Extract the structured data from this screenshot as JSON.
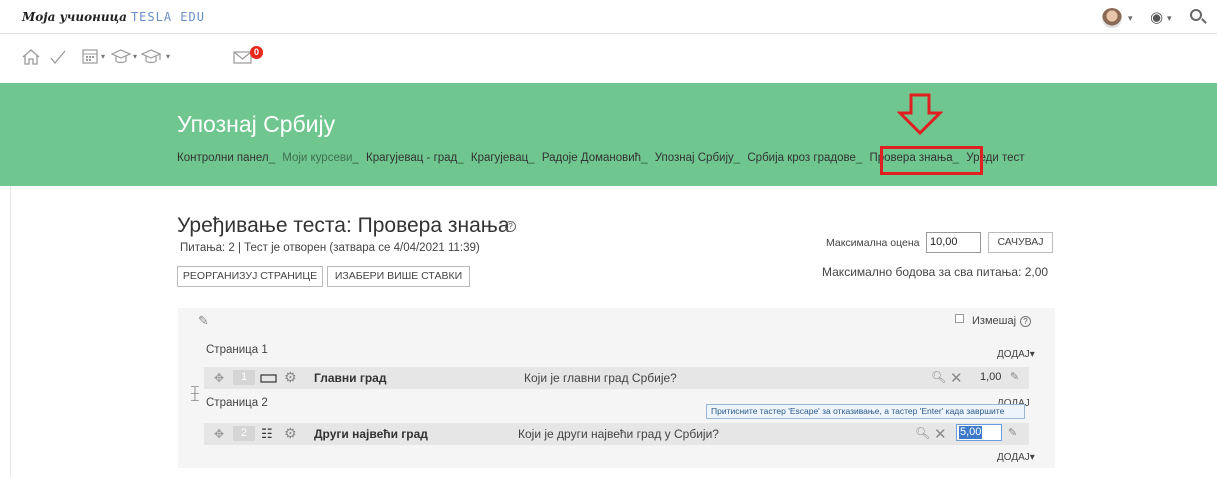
{
  "topbar": {
    "brand_primary": "Моја учионица",
    "brand_secondary": "TESLA EDU",
    "avatar_icon": "user-avatar",
    "help_icon": "globe-help-icon",
    "search_icon": "search-icon"
  },
  "toolbar": {
    "icons": [
      "home-icon",
      "check-icon",
      "calendar-icon",
      "graduation-cap-icon",
      "graduation-cap-outline-icon",
      "mail-icon"
    ],
    "mail_badge": "0"
  },
  "header": {
    "course_title": "Упознај Србију",
    "breadcrumb": [
      "Контролни панел",
      "Моји курсеви",
      "Крагујевац - град",
      "Крагујевац",
      "Радоје Домановић",
      "Упознај Србију",
      "Србија кроз градове",
      "Провера знања",
      "Уреди тест"
    ],
    "highlight_color": "#e02020",
    "accent_color": "#6fc68f"
  },
  "main": {
    "title": "Уређивање теста: Провера знања",
    "info": "Питања: 2 | Тест је отворен (затвара се 4/04/2021 11:39)",
    "btn_reorganize": "РЕОРГАНИЗУЈ СТРАНИЦЕ",
    "btn_select": "ИЗАБЕРИ ВИШЕ СТАВКИ",
    "max_grade_label": "Максимална оцена",
    "max_grade_value": "10,00",
    "save_label": "САЧУВАЈ",
    "max_points": "Максимално бодова за сва питања: 2,00"
  },
  "panel": {
    "shuffle_label": "Измешај",
    "add_label": "ДОДАЈ",
    "pages": [
      {
        "label": "Страница 1",
        "question": {
          "number": "1",
          "name": "Главни град",
          "text": "Који је главни град Србије?",
          "mark": "1,00"
        }
      },
      {
        "label": "Страница 2",
        "question": {
          "number": "2",
          "name": "Други највећи град",
          "text": "Који је други највећи град у Србији?",
          "mark": "5,00"
        }
      }
    ],
    "tooltip": "Притисните тастер 'Escape' за отказивање, а тастер 'Enter' када завршите"
  }
}
